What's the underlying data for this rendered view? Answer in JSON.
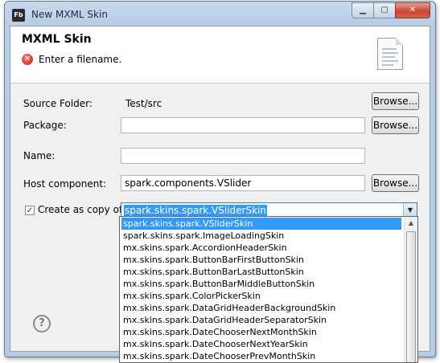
{
  "window": {
    "app_icon": "Fb",
    "title": "New MXML Skin",
    "minimize": "▁",
    "maximize": "▢",
    "close": "✕"
  },
  "header": {
    "title": "MXML Skin",
    "error_icon": "✕",
    "message": "Enter a filename."
  },
  "form": {
    "source_folder_label": "Source Folder:",
    "source_folder_value": "Test/src",
    "package_label": "Package:",
    "package_value": "",
    "name_label": "Name:",
    "name_value": "",
    "host_component_label": "Host component:",
    "host_component_value": "spark.components.VSlider",
    "browse_label": "Browse...",
    "create_copy_label": "Create as copy of:",
    "create_copy_checked": "✓",
    "create_copy_value": "spark.skins.spark.VSliderSkin"
  },
  "dropdown": {
    "items": [
      "spark.skins.spark.VSliderSkin",
      "spark.skins.spark.ImageLoadingSkin",
      "mx.skins.spark.AccordionHeaderSkin",
      "mx.skins.spark.ButtonBarFirstButtonSkin",
      "mx.skins.spark.ButtonBarLastButtonSkin",
      "mx.skins.spark.ButtonBarMiddleButtonSkin",
      "mx.skins.spark.ColorPickerSkin",
      "mx.skins.spark.DataGridHeaderBackgroundSkin",
      "mx.skins.spark.DataGridHeaderSeparatorSkin",
      "mx.skins.spark.DateChooserNextMonthSkin",
      "mx.skins.spark.DateChooserNextYearSkin",
      "mx.skins.spark.DateChooserPrevMonthSkin"
    ],
    "selected_index": 0,
    "scroll_up": "▲"
  },
  "footer": {
    "help_icon": "?"
  },
  "colors": {
    "selection": "#3399ff",
    "error": "#c8231a"
  },
  "icons": [
    "app-icon",
    "error-icon",
    "file-icon",
    "help-icon",
    "chevron-down-icon"
  ]
}
